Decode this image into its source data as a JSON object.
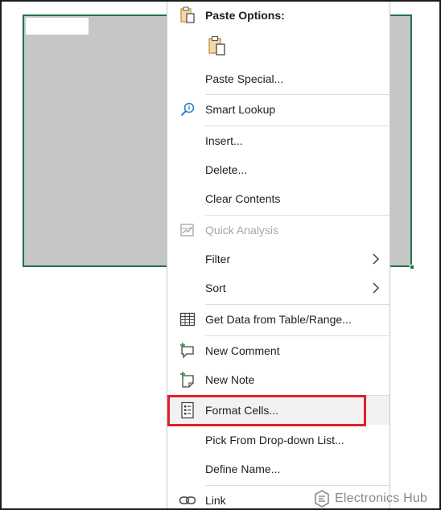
{
  "context_menu": {
    "paste_options_header": "Paste Options:",
    "items": {
      "paste_special": "Paste Special...",
      "smart_lookup": "Smart Lookup",
      "insert": "Insert...",
      "delete": "Delete...",
      "clear_contents": "Clear Contents",
      "quick_analysis": "Quick Analysis",
      "filter": "Filter",
      "sort": "Sort",
      "get_data": "Get Data from Table/Range...",
      "new_comment": "New Comment",
      "new_note": "New Note",
      "format_cells": "Format Cells...",
      "pick_from_list": "Pick From Drop-down List...",
      "define_name": "Define Name...",
      "link": "Link"
    },
    "icons": {
      "paste_header": "clipboard-icon",
      "paste_option": "clipboard-icon",
      "smart_lookup": "search-icon",
      "quick_analysis": "quick-analysis-icon",
      "get_data": "table-icon",
      "new_comment": "comment-icon",
      "new_note": "note-icon",
      "format_cells": "format-cells-icon",
      "link": "link-icon",
      "submenu": "chevron-right-icon"
    }
  },
  "watermark": {
    "text": "Electronics Hub"
  },
  "colors": {
    "selection_fill": "#c6c6c6",
    "selection_border": "#217346",
    "highlight_border": "#e0202a",
    "hover_fill": "#f2f2f2",
    "disabled_text": "#a6a6a6"
  }
}
